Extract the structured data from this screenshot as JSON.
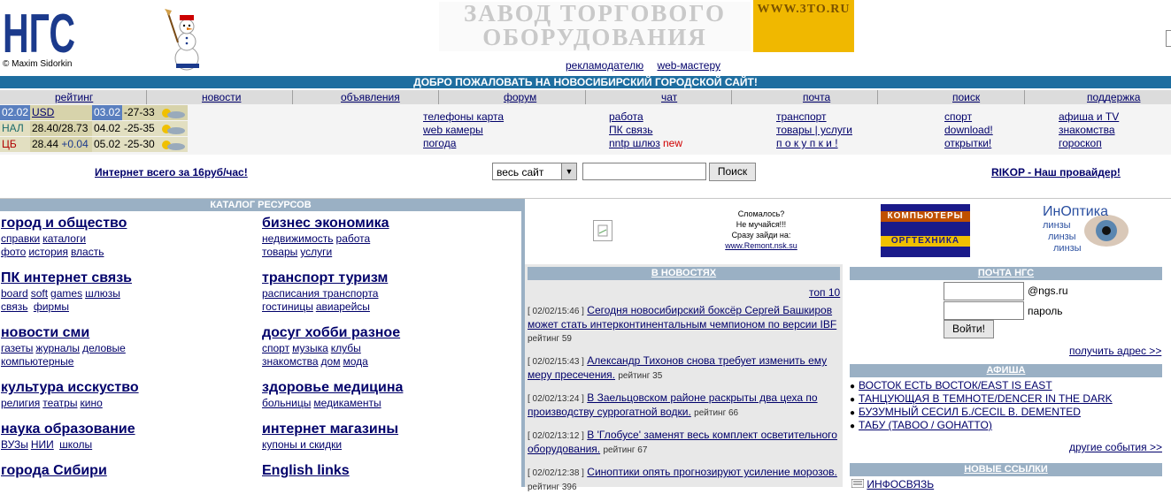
{
  "header": {
    "copyright": "© Maxim Sidorkin",
    "banner_line1": "ЗАВОД ТОРГОВОГО",
    "banner_line2": "ОБОРУДОВАНИЯ",
    "banner_url": "WWW.3TO.RU",
    "advertiser_link": "рекламодателю",
    "webmaster_link": "web-мастеру"
  },
  "welcome": "ДОБРО ПОЖАЛОВАТЬ НА НОВОСИБИРСКИЙ ГОРОДСКОЙ САЙТ!",
  "nav": [
    "рейтинг",
    "новости",
    "объявления",
    "форум",
    "чат",
    "почта",
    "поиск",
    "поддержка"
  ],
  "rates": {
    "date1": "02.02",
    "currency": "USD",
    "date2": "03.02",
    "temp1": "-27-33",
    "nal_label": "НАЛ",
    "nal_value": "28.40/28.73",
    "nal_date": "04.02",
    "nal_temp": "-25-35",
    "cb_label": "ЦБ",
    "cb_value": "28.44",
    "cb_change": "+0.04",
    "cb_date": "05.02",
    "cb_temp": "-25-30"
  },
  "info_links": {
    "col1": [
      "телефоны карта",
      "web камеры",
      "погода"
    ],
    "col2": [
      "работа",
      "ПК связь",
      "nntp шлюз"
    ],
    "col2_new": "new",
    "col3": [
      "транспорт",
      "товары | услуги",
      "п о к у п к и !"
    ],
    "col4": [
      "спорт",
      "download!",
      "открытки!"
    ],
    "col5": [
      "афиша и TV",
      "знакомства",
      "гороскоп"
    ]
  },
  "search": {
    "internet_ad": "Интернет всего за 16руб/час!",
    "scope": "весь сайт",
    "button": "Поиск",
    "provider": "RIKOP - Наш провайдер!"
  },
  "catalog": {
    "title": "КАТАЛОГ РЕСУРСОВ",
    "left": [
      {
        "head": "город и общество",
        "sub1": [
          "справки",
          "каталоги"
        ],
        "sub2": [
          "фото",
          "история",
          "власть"
        ]
      },
      {
        "head": "ПК интернет связь",
        "sub1": [
          "board",
          "soft",
          "games",
          "шлюзы"
        ],
        "sub2": [
          "связь",
          "фирмы"
        ]
      },
      {
        "head": "новости сми",
        "sub1": [
          "газеты",
          "журналы",
          "деловые"
        ],
        "sub2": [
          "компьютерные"
        ]
      },
      {
        "head": "культура исскуство",
        "sub1": [
          "религия",
          "театры",
          "кино"
        ],
        "sub2": []
      },
      {
        "head": "наука образование",
        "sub1": [
          "ВУЗы",
          "НИИ",
          "школы"
        ],
        "sub2": []
      },
      {
        "head": "города Сибири",
        "sub1": [],
        "sub2": []
      }
    ],
    "right": [
      {
        "head": "бизнес экономика",
        "sub1": [
          "недвижимость",
          "работа"
        ],
        "sub2": [
          "товары",
          "услуги"
        ]
      },
      {
        "head": "транспорт туризм",
        "sub1": [
          "расписания транспорта"
        ],
        "sub2": [
          "гостиницы",
          "авиарейсы"
        ]
      },
      {
        "head": "досуг хобби разное",
        "sub1": [
          "спорт",
          "музыка",
          "клубы"
        ],
        "sub2": [
          "знакомства",
          "дом",
          "мода"
        ]
      },
      {
        "head": "здоровье медицина",
        "sub1": [
          "больницы",
          "медикаменты"
        ],
        "sub2": []
      },
      {
        "head": "интернет магазины",
        "sub1": [
          "купоны и скидки"
        ],
        "sub2": []
      },
      {
        "head": "English links",
        "sub1": [],
        "sub2": []
      }
    ]
  },
  "ads": {
    "remont_lines": [
      "Сломалось?",
      "Не мучайся!!!",
      "Сразу зайди на:"
    ],
    "remont_link": "www.Remont.nsk.su",
    "comp_line1": "КОМПЬЮТЕРЫ",
    "comp_line2": "ОРГТЕХНИКА",
    "optics_title": "ИнОптика",
    "optics_word": "линзы"
  },
  "news": {
    "title": "В НОВОСТЯХ",
    "top10": "топ 10",
    "items": [
      {
        "time": "[ 02/02/15:46 ]",
        "text": "Сегодня новосибирский боксёр Сергей Башкиров может стать интерконтинентальным чемпионом по версии IBF",
        "rating": "рейтинг 59"
      },
      {
        "time": "[ 02/02/15:43 ]",
        "text": "Александр Тихонов снова требует изменить ему меру пресечения.",
        "rating": "рейтинг 35"
      },
      {
        "time": "[ 02/02/13:24 ]",
        "text": "В Заельцовском районе раскрыты два цеха по производству суррогатной водки.",
        "rating": "рейтинг 66"
      },
      {
        "time": "[ 02/02/13:12 ]",
        "text": "В 'Глобусе' заменят весь комплект осветительного оборудования.",
        "rating": "рейтинг 67"
      },
      {
        "time": "[ 02/02/12:38 ]",
        "text": "Синоптики опять прогнозируют усиление морозов.",
        "rating": "рейтинг 396"
      }
    ]
  },
  "mail": {
    "title": "ПОЧТА НГС",
    "domain": "@ngs.ru",
    "password_label": "пароль",
    "login_button": "Войти!",
    "get_address": "получить адрес >>"
  },
  "afisha": {
    "title": "АФИША",
    "items": [
      "ВОСТОК ЕСТЬ ВОСТОК/EAST IS EAST",
      "ТАНЦУЮЩАЯ В ТЕМНОТЕ/DENCER IN THE DARK",
      "БУЗУМНЫЙ СЕСИЛ Б./CECIL B. DEMENTED",
      "ТАБУ (TABOO / GOHATTO)"
    ],
    "other": "другие события >>"
  },
  "new_links": {
    "title": "НОВЫЕ ССЫЛКИ",
    "first": "ИНФОСВЯЗЬ"
  }
}
